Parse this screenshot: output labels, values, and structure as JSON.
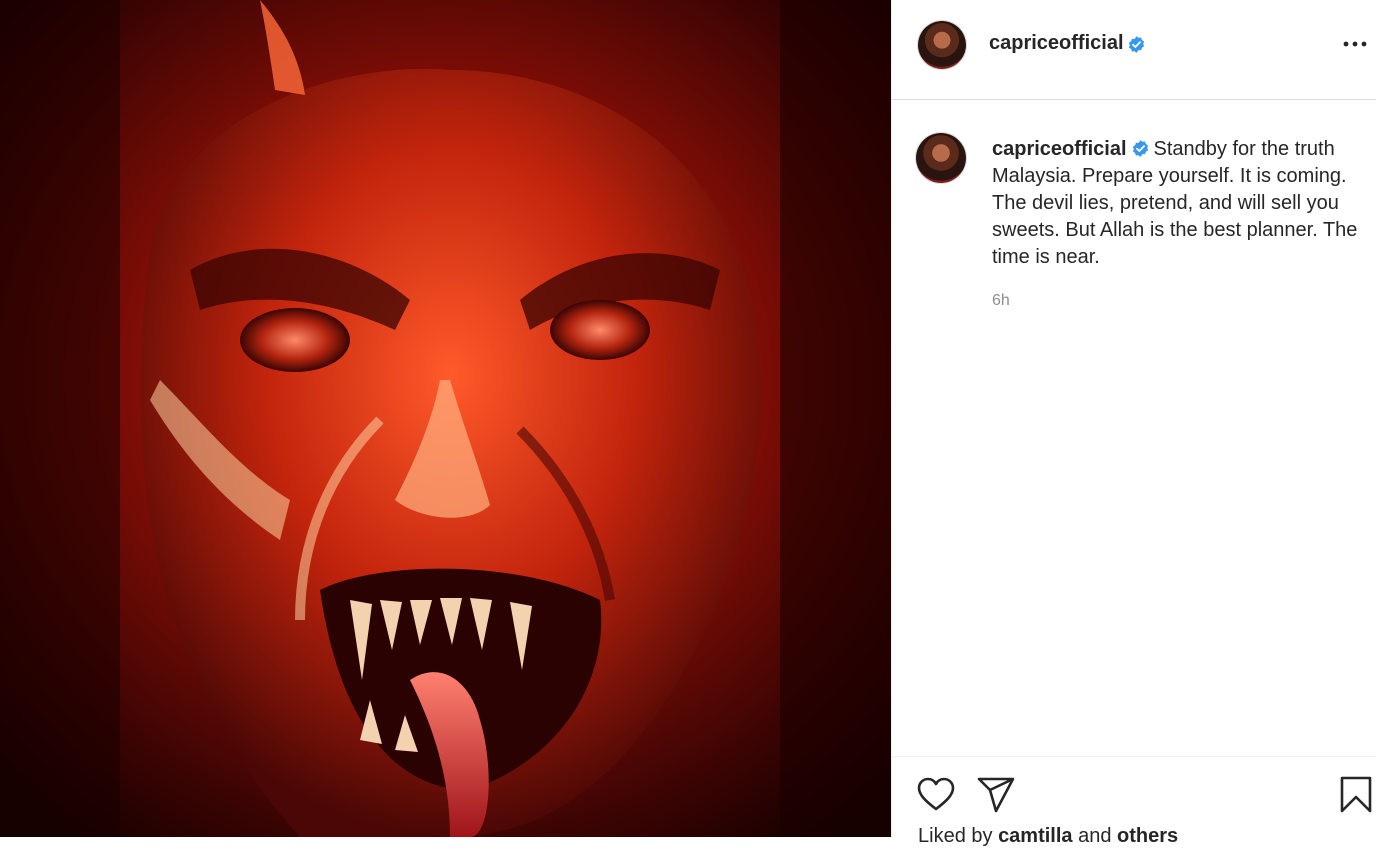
{
  "post": {
    "username": "capriceofficial",
    "verified": true,
    "image_alt": "red demonic face with fangs",
    "menu_icon": "more-options-icon"
  },
  "caption": {
    "username": "capriceofficial",
    "text": "Standby for the truth Malaysia. Prepare yourself. It is coming. The devil lies, pretend, and will sell you sweets. But Allah is the best planner. The time is near.",
    "time": "6h"
  },
  "actions": {
    "like_icon": "heart-icon",
    "share_icon": "paper-plane-icon",
    "save_icon": "bookmark-icon",
    "liked_prefix": "Liked by ",
    "liked_user": "camtilla",
    "liked_joiner": " and ",
    "liked_others": "others"
  },
  "colors": {
    "verified_badge": "#3897f0",
    "text_primary": "#262626",
    "text_secondary": "#8e8e8e",
    "divider": "#dbdbdb"
  }
}
